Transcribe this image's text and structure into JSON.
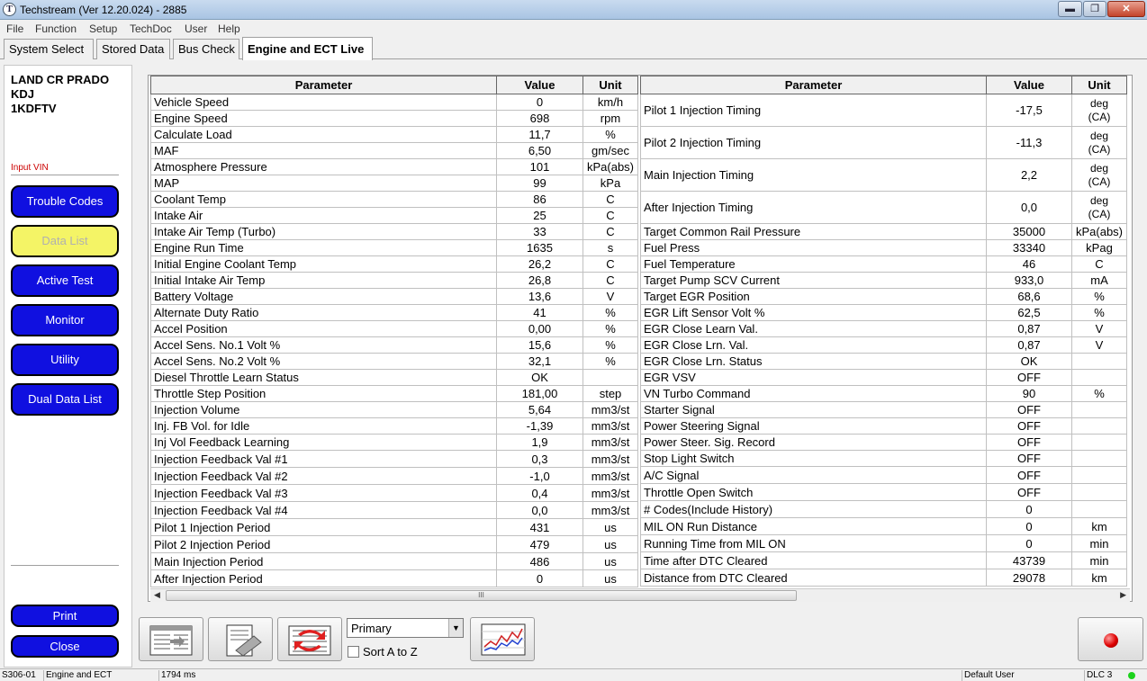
{
  "window": {
    "title": "Techstream (Ver 12.20.024) - 2885",
    "app_icon": "T"
  },
  "window_controls": {
    "minimize": "▬",
    "maximize": "❐",
    "close": "✕"
  },
  "menu": [
    "File",
    "Function",
    "Setup",
    "TechDoc",
    "User",
    "Help"
  ],
  "tabs": [
    "System Select",
    "Stored Data",
    "Bus Check",
    "Engine and ECT Live"
  ],
  "vehicle": {
    "model": "LAND CR PRADO",
    "engine_code": "KDJ",
    "engine": "1KDFTV"
  },
  "input_vin": "Input VIN",
  "nav_buttons": [
    "Trouble Codes",
    "Data List",
    "Active Test",
    "Monitor",
    "Utility",
    "Dual Data List"
  ],
  "bottom_buttons": {
    "print": "Print",
    "close": "Close"
  },
  "table_headers": {
    "parameter": "Parameter",
    "value": "Value",
    "unit": "Unit"
  },
  "left_rows": [
    {
      "p": "Vehicle Speed",
      "v": "0",
      "u": "km/h"
    },
    {
      "p": "Engine Speed",
      "v": "698",
      "u": "rpm"
    },
    {
      "p": "Calculate Load",
      "v": "11,7",
      "u": "%"
    },
    {
      "p": "MAF",
      "v": "6,50",
      "u": "gm/sec"
    },
    {
      "p": "Atmosphere Pressure",
      "v": "101",
      "u": "kPa(abs)"
    },
    {
      "p": "MAP",
      "v": "99",
      "u": "kPa"
    },
    {
      "p": "Coolant Temp",
      "v": "86",
      "u": "C"
    },
    {
      "p": "Intake Air",
      "v": "25",
      "u": "C"
    },
    {
      "p": "Intake Air Temp (Turbo)",
      "v": "33",
      "u": "C"
    },
    {
      "p": "Engine Run Time",
      "v": "1635",
      "u": "s"
    },
    {
      "p": "Initial Engine Coolant Temp",
      "v": "26,2",
      "u": "C"
    },
    {
      "p": "Initial Intake Air Temp",
      "v": "26,8",
      "u": "C"
    },
    {
      "p": "Battery Voltage",
      "v": "13,6",
      "u": "V"
    },
    {
      "p": "Alternate Duty Ratio",
      "v": "41",
      "u": "%"
    },
    {
      "p": "Accel Position",
      "v": "0,00",
      "u": "%"
    },
    {
      "p": "Accel Sens. No.1 Volt %",
      "v": "15,6",
      "u": "%"
    },
    {
      "p": "Accel Sens. No.2 Volt %",
      "v": "32,1",
      "u": "%"
    },
    {
      "p": "Diesel Throttle Learn Status",
      "v": "OK",
      "u": ""
    },
    {
      "p": "Throttle Step Position",
      "v": "181,00",
      "u": "step"
    },
    {
      "p": "Injection Volume",
      "v": "5,64",
      "u": "mm3/st"
    },
    {
      "p": "Inj. FB Vol. for Idle",
      "v": "-1,39",
      "u": "mm3/st"
    },
    {
      "p": "Inj Vol Feedback Learning",
      "v": "1,9",
      "u": "mm3/st"
    },
    {
      "p": "Injection Feedback Val #1",
      "v": "0,3",
      "u": "mm3/st"
    },
    {
      "p": "Injection Feedback Val #2",
      "v": "-1,0",
      "u": "mm3/st"
    },
    {
      "p": "Injection Feedback Val #3",
      "v": "0,4",
      "u": "mm3/st"
    },
    {
      "p": "Injection Feedback Val #4",
      "v": "0,0",
      "u": "mm3/st"
    },
    {
      "p": "Pilot 1 Injection Period",
      "v": "431",
      "u": "us"
    },
    {
      "p": "Pilot 2 Injection Period",
      "v": "479",
      "u": "us"
    },
    {
      "p": "Main Injection Period",
      "v": "486",
      "u": "us"
    },
    {
      "p": "After Injection Period",
      "v": "0",
      "u": "us"
    }
  ],
  "right_rows": [
    {
      "p": "Pilot 1 Injection Timing",
      "v": "-17,5",
      "u": "deg",
      "u2": "(CA)"
    },
    {
      "p": "Pilot 2 Injection Timing",
      "v": "-11,3",
      "u": "deg",
      "u2": "(CA)"
    },
    {
      "p": "Main Injection Timing",
      "v": "2,2",
      "u": "deg",
      "u2": "(CA)"
    },
    {
      "p": "After Injection Timing",
      "v": "0,0",
      "u": "deg",
      "u2": "(CA)"
    },
    {
      "p": "Target Common Rail Pressure",
      "v": "35000",
      "u": "kPa(abs)"
    },
    {
      "p": "Fuel Press",
      "v": "33340",
      "u": "kPag"
    },
    {
      "p": "Fuel Temperature",
      "v": "46",
      "u": "C"
    },
    {
      "p": "Target Pump SCV Current",
      "v": "933,0",
      "u": "mA"
    },
    {
      "p": "Target EGR Position",
      "v": "68,6",
      "u": "%"
    },
    {
      "p": "EGR Lift Sensor Volt %",
      "v": "62,5",
      "u": "%"
    },
    {
      "p": "EGR Close Learn Val.",
      "v": "0,87",
      "u": "V"
    },
    {
      "p": "EGR Close Lrn. Val.",
      "v": "0,87",
      "u": "V"
    },
    {
      "p": "EGR Close Lrn. Status",
      "v": "OK",
      "u": ""
    },
    {
      "p": "EGR VSV",
      "v": "OFF",
      "u": ""
    },
    {
      "p": "VN Turbo Command",
      "v": "90",
      "u": "%"
    },
    {
      "p": "Starter Signal",
      "v": "OFF",
      "u": ""
    },
    {
      "p": "Power Steering Signal",
      "v": "OFF",
      "u": ""
    },
    {
      "p": "Power Steer. Sig. Record",
      "v": "OFF",
      "u": ""
    },
    {
      "p": "Stop Light Switch",
      "v": "OFF",
      "u": ""
    },
    {
      "p": "A/C Signal",
      "v": "OFF",
      "u": ""
    },
    {
      "p": "Throttle Open Switch",
      "v": "OFF",
      "u": ""
    },
    {
      "p": "# Codes(Include History)",
      "v": "0",
      "u": ""
    },
    {
      "p": "MIL ON Run Distance",
      "v": "0",
      "u": "km"
    },
    {
      "p": "Running Time from MIL ON",
      "v": "0",
      "u": "min"
    },
    {
      "p": "Time after DTC Cleared",
      "v": "43739",
      "u": "min"
    },
    {
      "p": "Distance from DTC Cleared",
      "v": "29078",
      "u": "km"
    }
  ],
  "scrollbar": {
    "left_arrow": "◀",
    "right_arrow": "▶",
    "grip": "III"
  },
  "toolbar": {
    "primary_value": "Primary",
    "dropdown_arrow": "▼",
    "sort_label": "Sort A to Z"
  },
  "status": {
    "code": "S306-01",
    "system": "Engine and ECT",
    "interval": "1794 ms",
    "user": "Default User",
    "dlc": "DLC 3"
  },
  "colors": {
    "nav_blue": "#1010e0",
    "nav_selected": "#f4f466",
    "vin_red": "#cc0000",
    "status_green": "#1cd21c"
  }
}
